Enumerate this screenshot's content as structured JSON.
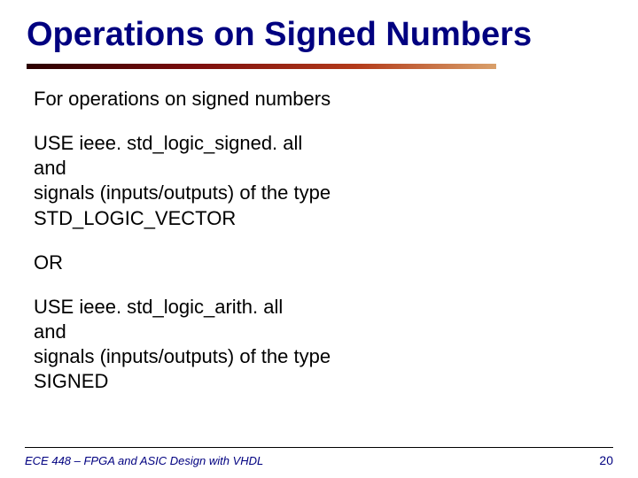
{
  "title": "Operations on Signed Numbers",
  "body": {
    "intro": "For operations on signed numbers",
    "block1_l1": "USE ieee. std_logic_signed. all",
    "block1_l2": "and",
    "block1_l3": "signals (inputs/outputs) of the type",
    "block1_l4": "STD_LOGIC_VECTOR",
    "or": "OR",
    "block2_l1": "USE ieee. std_logic_arith. all",
    "block2_l2": "and",
    "block2_l3": "signals (inputs/outputs) of the type",
    "block2_l4": "SIGNED"
  },
  "footer": {
    "course": "ECE 448 – FPGA and ASIC Design with VHDL",
    "page": "20"
  }
}
